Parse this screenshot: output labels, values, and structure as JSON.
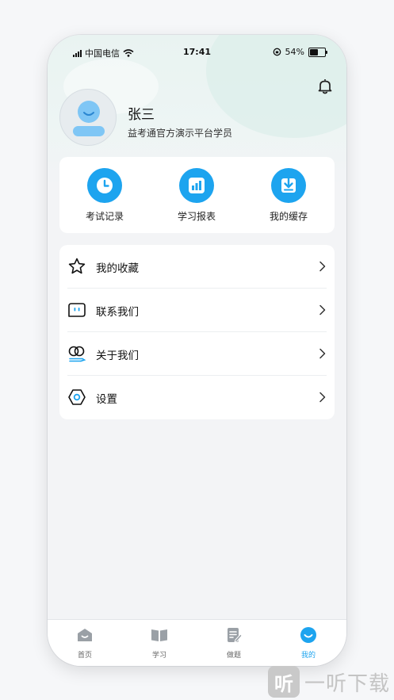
{
  "status_bar": {
    "carrier": "中国电信",
    "time": "17:41",
    "battery": "54%",
    "battery_level": 0.54
  },
  "profile": {
    "name": "张三",
    "subtitle": "益考通官方演示平台学员"
  },
  "quick_actions": [
    {
      "label": "考试记录",
      "icon": "clock-icon"
    },
    {
      "label": "学习报表",
      "icon": "bar-chart-icon"
    },
    {
      "label": "我的缓存",
      "icon": "download-icon"
    }
  ],
  "menu": [
    {
      "label": "我的收藏",
      "icon": "star-icon"
    },
    {
      "label": "联系我们",
      "icon": "chat-icon"
    },
    {
      "label": "关于我们",
      "icon": "about-icon"
    },
    {
      "label": "设置",
      "icon": "settings-icon"
    }
  ],
  "tabs": [
    {
      "label": "首页",
      "icon": "home-icon",
      "active": false
    },
    {
      "label": "学习",
      "icon": "book-icon",
      "active": false
    },
    {
      "label": "做题",
      "icon": "exercise-icon",
      "active": false
    },
    {
      "label": "我的",
      "icon": "profile-icon",
      "active": true
    }
  ],
  "colors": {
    "accent": "#1da4ef",
    "inactive_icon": "#9aa0a6"
  },
  "watermark": {
    "logo_text": "听",
    "text": "一听下载"
  }
}
